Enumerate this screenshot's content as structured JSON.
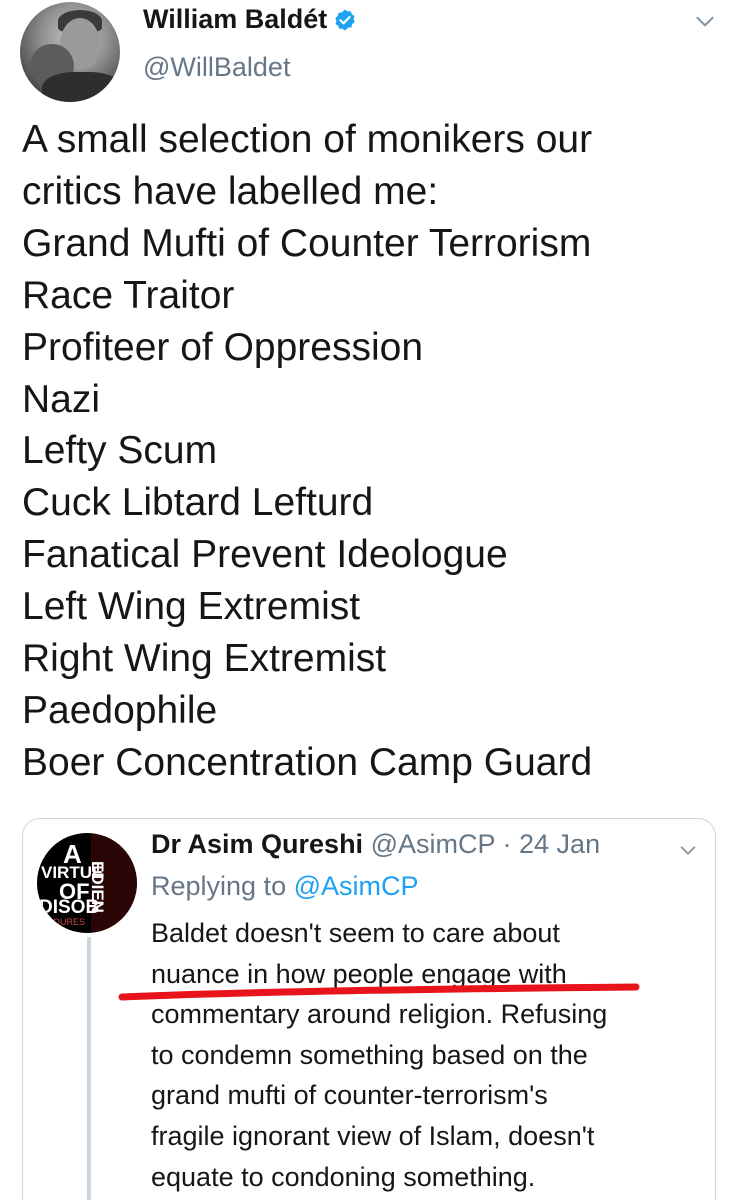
{
  "tweet": {
    "author_name": "William Baldét",
    "author_handle": "@WillBaldet",
    "text_lines": [
      "A small selection of monikers our",
      "critics have labelled me:",
      "Grand Mufti of Counter Terrorism",
      "Race Traitor",
      "Profiteer of Oppression",
      "Nazi",
      "Lefty Scum",
      "Cuck Libtard Lefturd",
      "Fanatical Prevent Ideologue",
      "Left Wing Extremist",
      "Right Wing Extremist",
      "Paedophile",
      "Boer Concentration Camp Guard"
    ]
  },
  "quoted_tweet": {
    "author_name": "Dr Asim Qureshi",
    "author_handle": "@AsimCP",
    "separator": " · ",
    "date": "24 Jan",
    "replying_prefix": "Replying to ",
    "replying_to": "@AsimCP",
    "avatar_text": {
      "line1": "A",
      "line2": "VIRTUE",
      "line3": "OF",
      "line4": "DISOB",
      "line5": "EDIEN",
      "line6": "M QURES"
    },
    "text_lines": [
      "Baldet doesn't seem to care about",
      "nuance in how people engage with",
      "commentary around religion. Refusing",
      "to condemn something based on the",
      "grand mufti of counter-terrorism's",
      "fragile ignorant view of Islam, doesn't",
      "equate to condoning something."
    ]
  },
  "colors": {
    "verified": "#1da1f2",
    "link": "#1da1f2",
    "secondary_text": "#657786",
    "annotation_underline": "#e8141b"
  },
  "icons": {
    "verified": "verified-badge-icon",
    "caret": "chevron-down-icon"
  }
}
